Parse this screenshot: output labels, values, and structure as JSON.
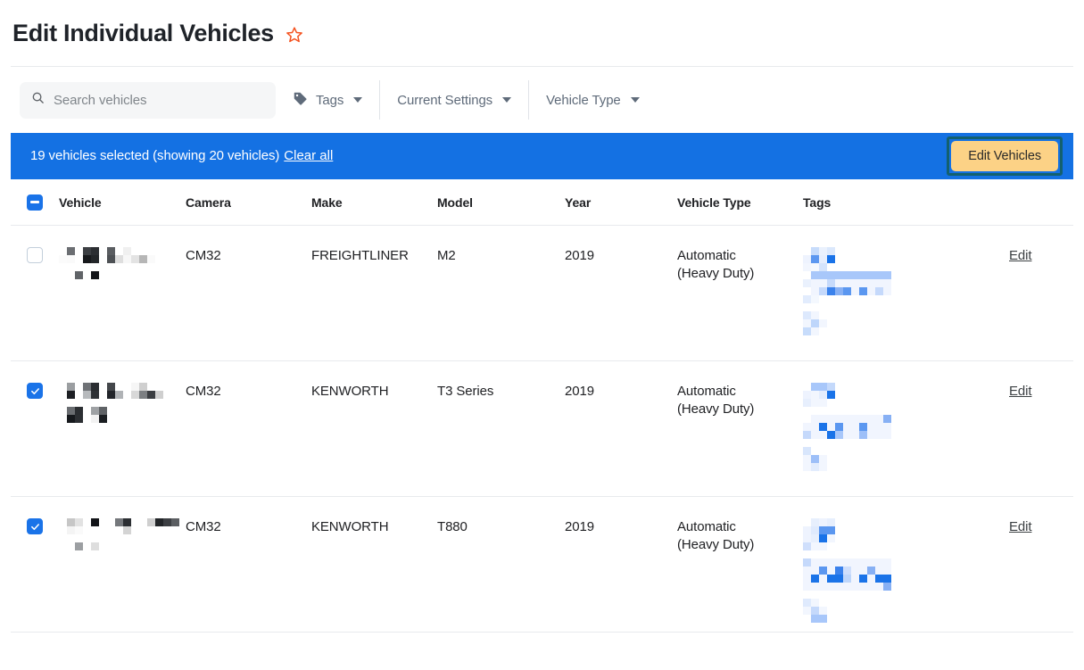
{
  "header": {
    "title": "Edit Individual Vehicles",
    "favorite_icon": "star-outline-icon",
    "favorite_color": "#f4511e"
  },
  "toolbar": {
    "search": {
      "icon": "search-icon",
      "placeholder": "Search vehicles",
      "value": ""
    },
    "filters": [
      {
        "label": "Tags",
        "icon": "tag-icon",
        "caret": "chevron-down-icon"
      },
      {
        "label": "Current Settings",
        "icon": "",
        "caret": "chevron-down-icon"
      },
      {
        "label": "Vehicle Type",
        "icon": "",
        "caret": "chevron-down-icon"
      }
    ]
  },
  "selection_banner": {
    "background": "#1471e3",
    "message": "19 vehicles selected (showing 20 vehicles)",
    "clear_all_label": "Clear all",
    "action_button": {
      "label": "Edit Vehicles",
      "background": "#fcd286",
      "highlight_border": "#13606e"
    }
  },
  "table": {
    "select_all_state": "indeterminate",
    "columns": [
      "Vehicle",
      "Camera",
      "Make",
      "Model",
      "Year",
      "Vehicle Type",
      "Tags"
    ],
    "rows": [
      {
        "selected": false,
        "vehicle": "",
        "vehicle_redacted": true,
        "camera": "CM32",
        "make": "FREIGHTLINER",
        "model": "M2",
        "year": "2019",
        "vehicle_type_line1": "Automatic",
        "vehicle_type_line2": "(Heavy Duty)",
        "tags": "",
        "tags_redacted": true,
        "edit_label": "Edit"
      },
      {
        "selected": true,
        "vehicle": "",
        "vehicle_redacted": true,
        "camera": "CM32",
        "make": "KENWORTH",
        "model": "T3 Series",
        "year": "2019",
        "vehicle_type_line1": "Automatic",
        "vehicle_type_line2": "(Heavy Duty)",
        "tags": "",
        "tags_redacted": true,
        "edit_label": "Edit"
      },
      {
        "selected": true,
        "vehicle": "",
        "vehicle_redacted": true,
        "camera": "CM32",
        "make": "KENWORTH",
        "model": "T880",
        "year": "2019",
        "vehicle_type_line1": "Automatic",
        "vehicle_type_line2": "(Heavy Duty)",
        "tags": "",
        "tags_redacted": true,
        "edit_label": "Edit"
      }
    ]
  },
  "colors": {
    "accent_blue": "#1a73e8",
    "banner_blue": "#1471e3",
    "border": "#e8eaed",
    "text": "#202124",
    "muted_text": "#5f6b7a"
  }
}
